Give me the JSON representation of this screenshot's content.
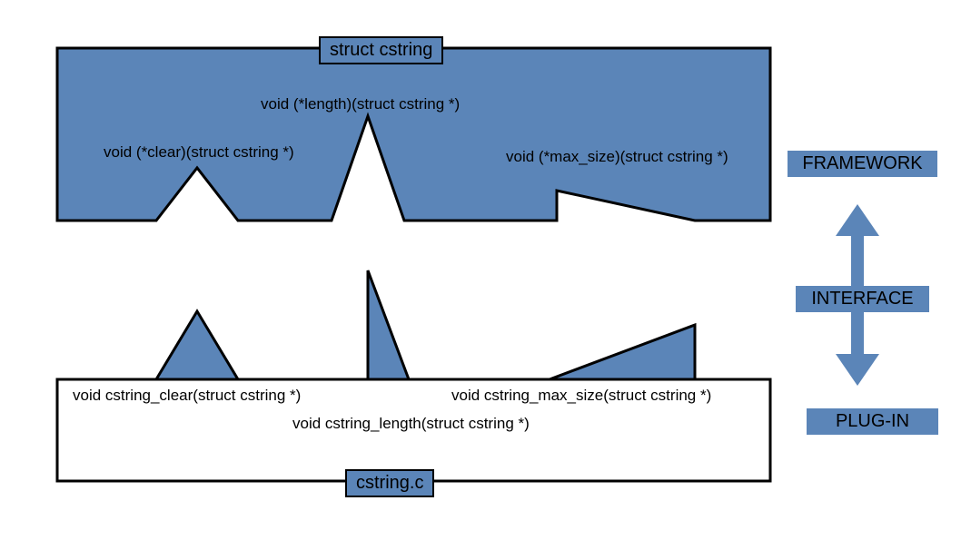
{
  "top": {
    "title": "struct cstring",
    "fn_clear": "void (*clear)(struct cstring *)",
    "fn_length": "void (*length)(struct cstring *)",
    "fn_max_size": "void (*max_size)(struct cstring *)"
  },
  "bottom": {
    "title": "cstring.c",
    "fn_clear": "void cstring_clear(struct cstring *)",
    "fn_length": "void cstring_length(struct cstring *)",
    "fn_max_size": "void cstring_max_size(struct cstring *)"
  },
  "side": {
    "framework": "FRAMEWORK",
    "interface": "INTERFACE",
    "plugin": "PLUG-IN"
  },
  "colors": {
    "blue": "#5b85b8"
  }
}
